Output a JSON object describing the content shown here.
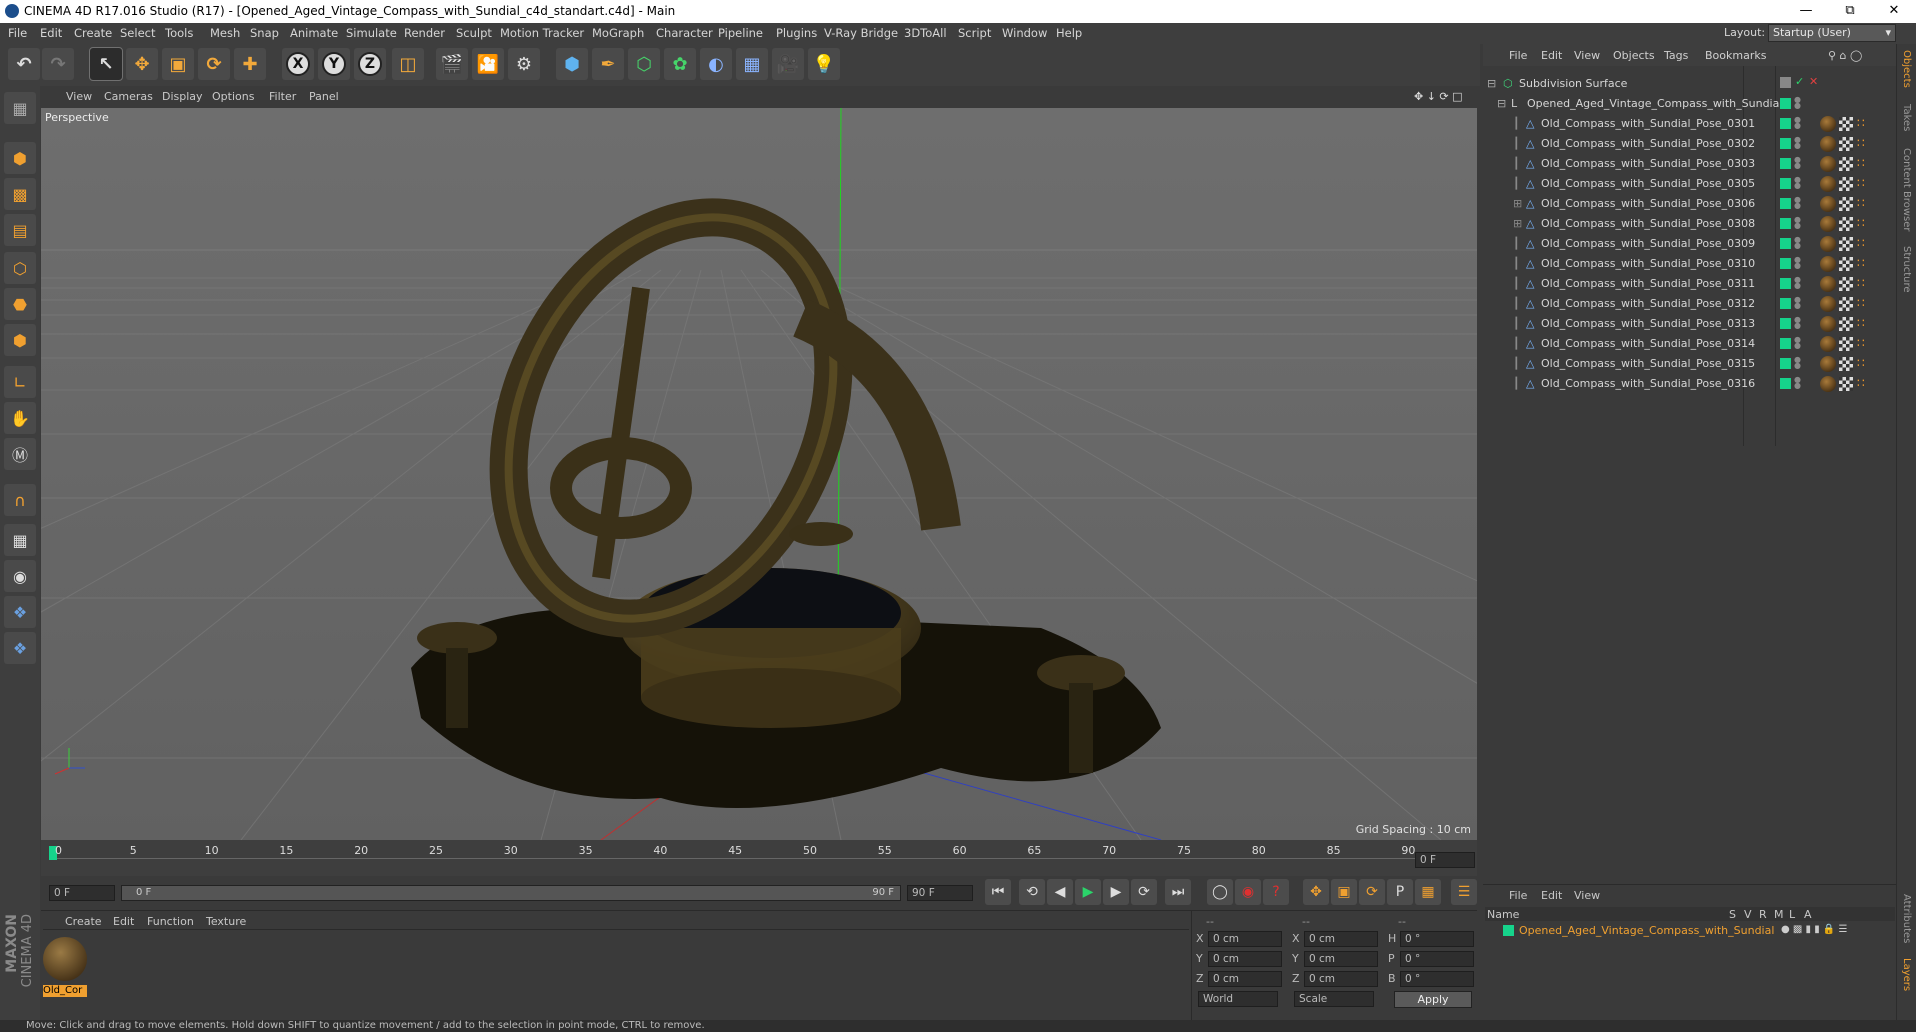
{
  "window": {
    "title": "CINEMA 4D R17.016 Studio (R17) - [Opened_Aged_Vintage_Compass_with_Sundial_c4d_standart.c4d] - Main",
    "min_icon": "minimize-icon",
    "max_icon": "restore-icon",
    "close_icon": "close-icon"
  },
  "menubar": {
    "items": [
      "File",
      "Edit",
      "Create",
      "Select",
      "Tools",
      "Mesh",
      "Snap",
      "Animate",
      "Simulate",
      "Render",
      "Sculpt",
      "Motion Tracker",
      "MoGraph",
      "Character",
      "Pipeline",
      "Plugins",
      "V-Ray Bridge",
      "3DToAll",
      "Script",
      "Window",
      "Help"
    ],
    "layout_label": "Layout:",
    "layout_value": "Startup (User)"
  },
  "viewport": {
    "menu": [
      "View",
      "Cameras",
      "Display",
      "Options",
      "Filter",
      "Panel"
    ],
    "label": "Perspective",
    "grid_spacing": "Grid Spacing : 10 cm"
  },
  "timeline": {
    "ticks": [
      "0",
      "5",
      "10",
      "15",
      "20",
      "25",
      "30",
      "35",
      "40",
      "45",
      "50",
      "55",
      "60",
      "65",
      "70",
      "75",
      "80",
      "85",
      "90"
    ],
    "current_frame": "0 F",
    "start_field": "0 F",
    "slider_start": "0 F",
    "slider_end": "90 F",
    "end_field": "90 F"
  },
  "material_manager": {
    "menu": [
      "Create",
      "Edit",
      "Function",
      "Texture"
    ],
    "material_name": "Old_Cor"
  },
  "coords": {
    "header": [
      "--",
      "--",
      "--"
    ],
    "rows": [
      {
        "a": "X",
        "av": "0 cm",
        "b": "X",
        "bv": "0 cm",
        "c": "H",
        "cv": "0 °"
      },
      {
        "a": "Y",
        "av": "0 cm",
        "b": "Y",
        "bv": "0 cm",
        "c": "P",
        "cv": "0 °"
      },
      {
        "a": "Z",
        "av": "0 cm",
        "b": "Z",
        "bv": "0 cm",
        "c": "B",
        "cv": "0 °"
      }
    ],
    "space": "World",
    "mode": "Scale",
    "apply": "Apply"
  },
  "object_manager": {
    "menu": [
      "File",
      "Edit",
      "View",
      "Objects",
      "Tags",
      "Bookmarks"
    ],
    "root": "Subdivision Surface",
    "group": "Opened_Aged_Vintage_Compass_with_Sundial",
    "children": [
      "Old_Compass_with_Sundial_Pose_0301",
      "Old_Compass_with_Sundial_Pose_0302",
      "Old_Compass_with_Sundial_Pose_0303",
      "Old_Compass_with_Sundial_Pose_0305",
      "Old_Compass_with_Sundial_Pose_0306",
      "Old_Compass_with_Sundial_Pose_0308",
      "Old_Compass_with_Sundial_Pose_0309",
      "Old_Compass_with_Sundial_Pose_0310",
      "Old_Compass_with_Sundial_Pose_0311",
      "Old_Compass_with_Sundial_Pose_0312",
      "Old_Compass_with_Sundial_Pose_0313",
      "Old_Compass_with_Sundial_Pose_0314",
      "Old_Compass_with_Sundial_Pose_0315",
      "Old_Compass_with_Sundial_Pose_0316"
    ]
  },
  "layer_manager": {
    "menu": [
      "File",
      "Edit",
      "View"
    ],
    "col_name": "Name",
    "cols": [
      "S",
      "V",
      "R",
      "M",
      "L",
      "A"
    ],
    "layer": "Opened_Aged_Vintage_Compass_with_Sundial"
  },
  "right_tabs": [
    "Objects",
    "Takes",
    "Content Browser",
    "Structure",
    "Attributes",
    "Layers"
  ],
  "left_logo": [
    "MAXON",
    "CINEMA 4D"
  ],
  "status": "Move: Click and drag to move elements. Hold down SHIFT to quantize movement / add to the selection in point mode, CTRL to remove.",
  "colors": {
    "accent": "#f39a2b",
    "checked": "#16d38b",
    "highlight": "#f0a030"
  }
}
